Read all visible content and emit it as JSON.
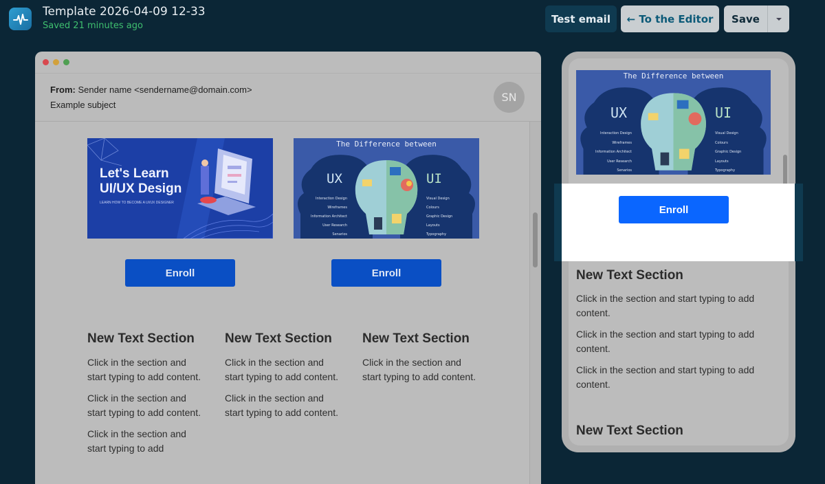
{
  "header": {
    "title": "Template 2026-04-09 12-33",
    "saved_status": "Saved 21 minutes ago"
  },
  "toolbar": {
    "test_email_label": "Test email",
    "to_editor_label": "← To the Editor",
    "save_label": "Save",
    "save_menu_icon": "chevron-down-icon"
  },
  "email": {
    "from_label": "From:",
    "from_value": "Sender name <sendername@domain.com>",
    "subject": "Example subject",
    "avatar_initials": "SN"
  },
  "banners": {
    "learn": {
      "line1": "Let's Learn",
      "line2": "UI/UX Design",
      "tagline": "LEARN HOW TO BECOME A UI/UX DESIGNER"
    },
    "difference": {
      "title": "The Difference between",
      "left_heading": "UX",
      "right_heading": "UI",
      "left_items": [
        "Interaction Design",
        "Wireframes",
        "Information Architect",
        "User Research",
        "Senarios"
      ],
      "right_items": [
        "Visual Design",
        "Colours",
        "Graphic Design",
        "Layouts",
        "Typography"
      ]
    }
  },
  "buttons": {
    "enroll_label": "Enroll"
  },
  "text_sections": {
    "heading": "New Text Section",
    "paragraph": "Click in the section and start typing to add content.",
    "desktop_col1_partial": "Click in the section and start typing to add"
  },
  "colors": {
    "background": "#0b2636",
    "accent_green": "#3fbf6f",
    "enroll_blue": "#0a66ff"
  }
}
